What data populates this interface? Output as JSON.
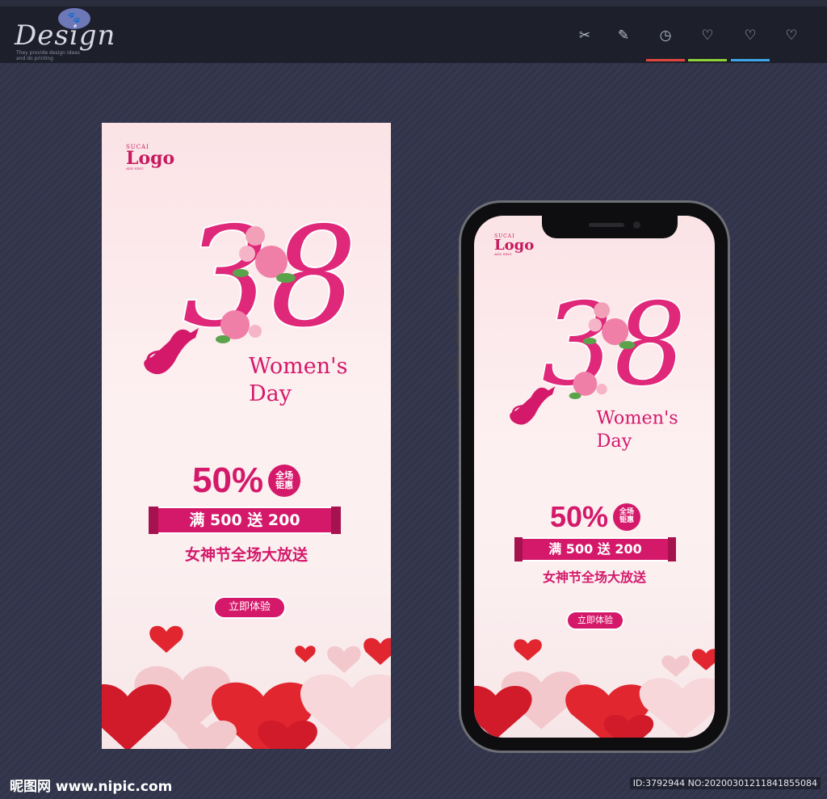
{
  "header": {
    "brand_word": "Design",
    "brand_bubble": "🐾",
    "brand_tagline": "They provide design ideas and do printing",
    "tools": [
      {
        "name": "scissors-icon",
        "glyph": "✂",
        "accent": ""
      },
      {
        "name": "pencil-icon",
        "glyph": "✎",
        "accent": ""
      },
      {
        "name": "check-circle-icon",
        "glyph": "◷",
        "accent": "#e0463f"
      },
      {
        "name": "heart-icon",
        "glyph": "♡",
        "accent": "#8fd13a"
      },
      {
        "name": "heart-plus-icon",
        "glyph": "♡",
        "accent": "#3ea6e8"
      },
      {
        "name": "heart-minus-icon",
        "glyph": "♡",
        "accent": ""
      }
    ]
  },
  "poster": {
    "logo_small": "SUCAI",
    "logo_big": "Logo",
    "logo_tiny": "ADD SING",
    "number": "38",
    "title_line1": "Women's",
    "title_line2": "Day",
    "percent": "50%",
    "badge_line1": "全场",
    "badge_line2": "钜惠",
    "ribbon_text": "满 500 送 200",
    "subtitle": "女神节全场大放送",
    "cta": "立即体验"
  },
  "footer": {
    "site": "昵图网 www.nipic.com",
    "id_text": "ID:3792944 NO:20200301211841855084"
  },
  "colors": {
    "accent": "#d4196a",
    "background": "#31344a",
    "topbar": "#1d1f2b"
  }
}
